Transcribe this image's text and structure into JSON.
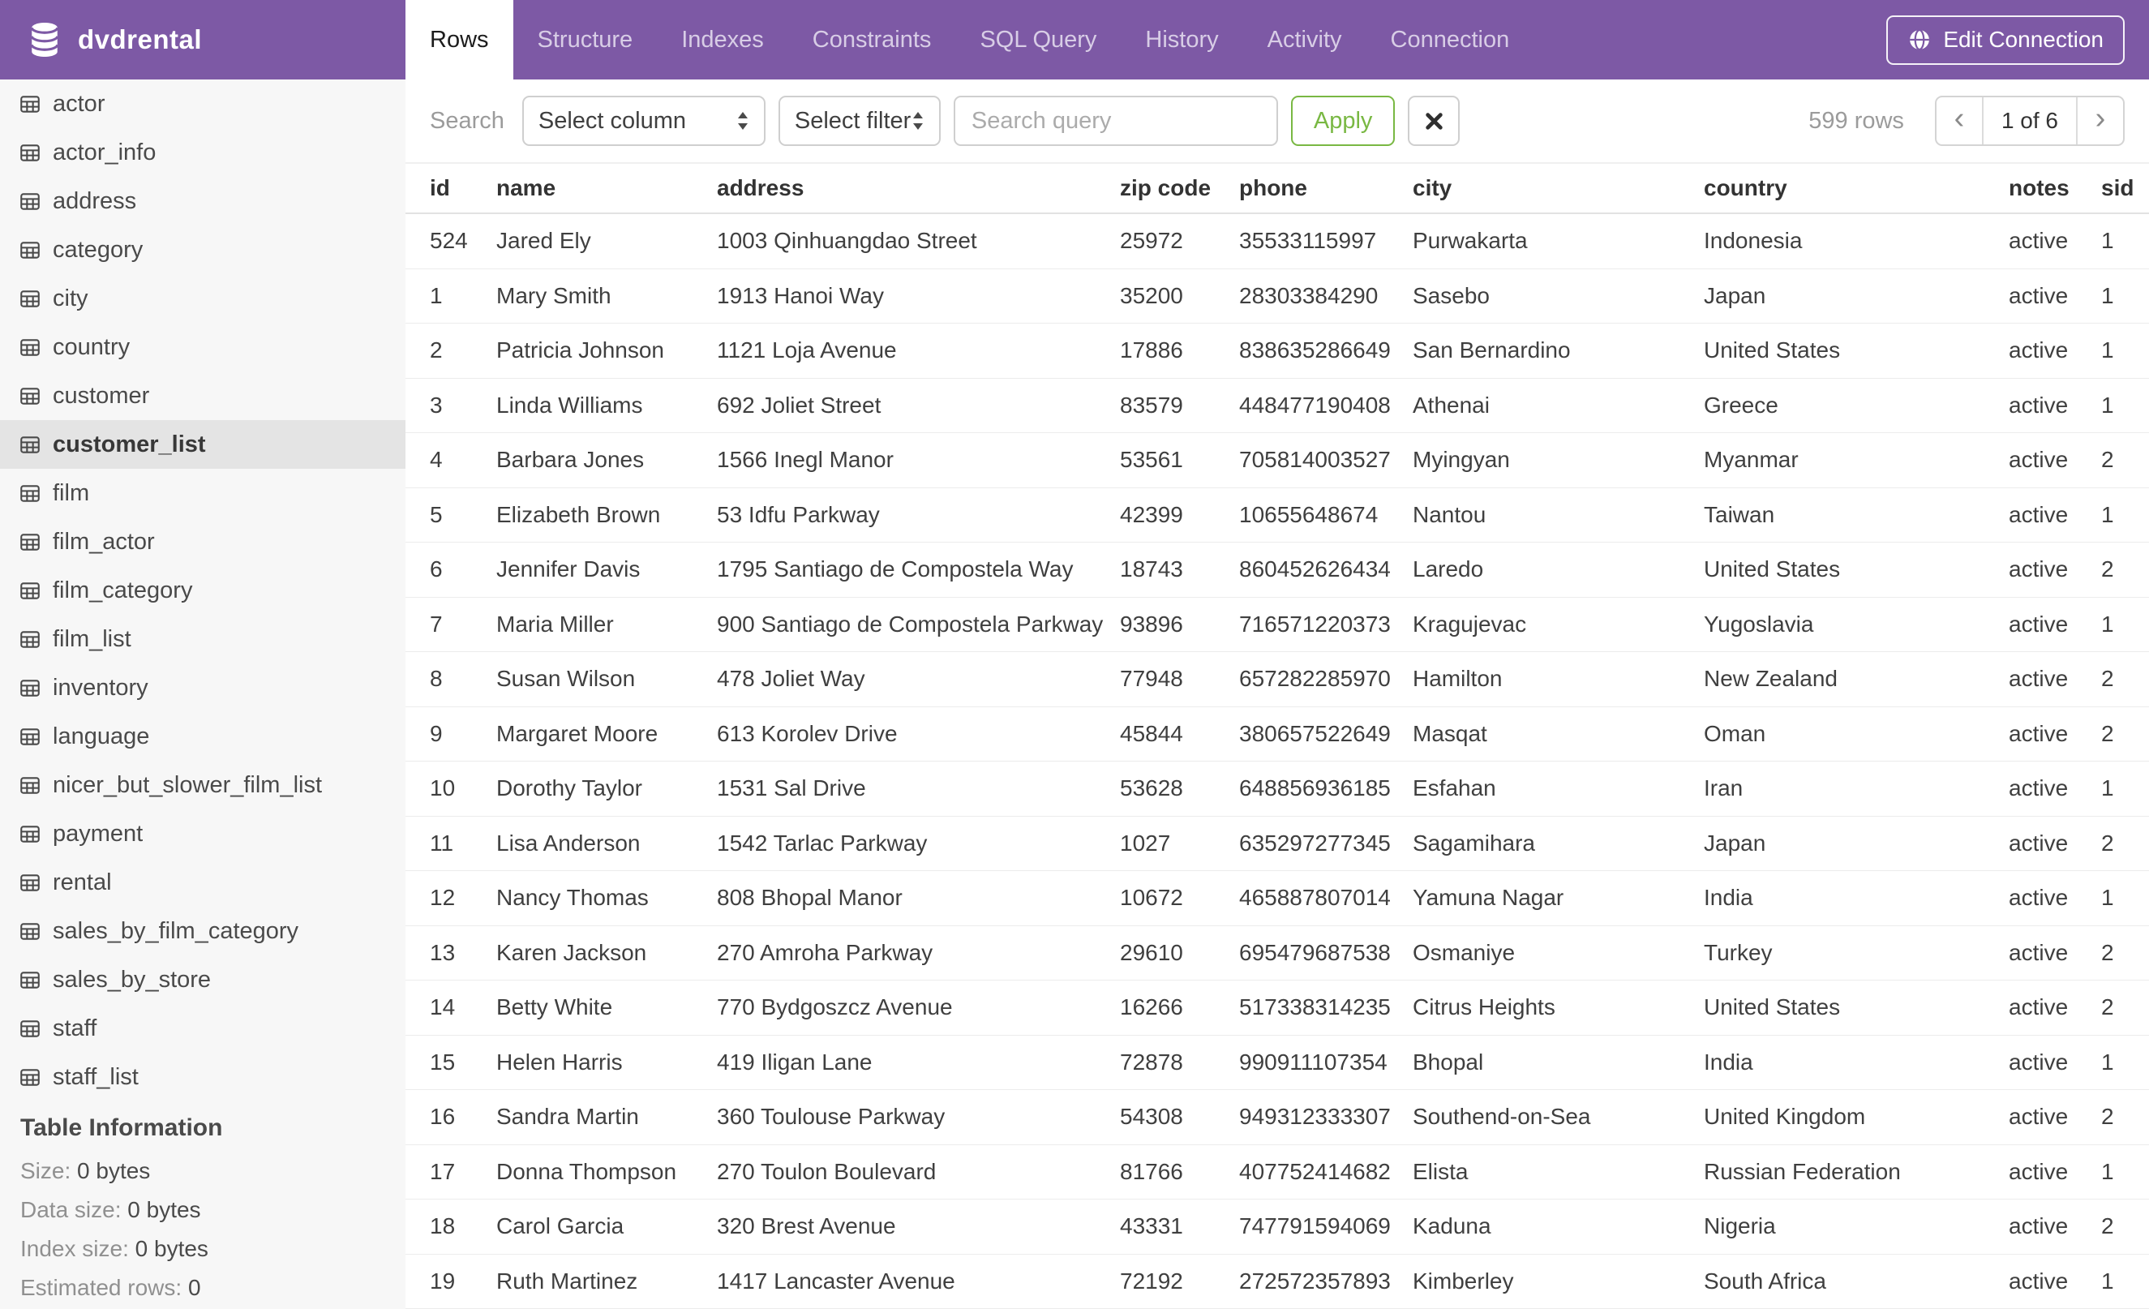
{
  "header": {
    "brand": "dvdrental",
    "tabs": [
      {
        "label": "Rows",
        "active": true
      },
      {
        "label": "Structure",
        "active": false
      },
      {
        "label": "Indexes",
        "active": false
      },
      {
        "label": "Constraints",
        "active": false
      },
      {
        "label": "SQL Query",
        "active": false
      },
      {
        "label": "History",
        "active": false
      },
      {
        "label": "Activity",
        "active": false
      },
      {
        "label": "Connection",
        "active": false
      }
    ],
    "edit_connection_label": "Edit Connection"
  },
  "sidebar": {
    "tables": [
      "actor",
      "actor_info",
      "address",
      "category",
      "city",
      "country",
      "customer",
      "customer_list",
      "film",
      "film_actor",
      "film_category",
      "film_list",
      "inventory",
      "language",
      "nicer_but_slower_film_list",
      "payment",
      "rental",
      "sales_by_film_category",
      "sales_by_store",
      "staff",
      "staff_list"
    ],
    "selected_table": "customer_list",
    "info": {
      "heading": "Table Information",
      "items": [
        {
          "label": "Size:",
          "value": "0 bytes"
        },
        {
          "label": "Data size:",
          "value": "0 bytes"
        },
        {
          "label": "Index size:",
          "value": "0 bytes"
        },
        {
          "label": "Estimated rows:",
          "value": "0"
        }
      ]
    }
  },
  "toolbar": {
    "search_label": "Search",
    "column_select_value": "Select column",
    "filter_select_value": "Select filter",
    "query_value": "",
    "query_placeholder": "Search query",
    "apply_label": "Apply",
    "row_count": "599 rows",
    "pagination": {
      "prev": "‹",
      "page": "1 of 6",
      "next": "›"
    }
  },
  "table": {
    "columns": [
      "id",
      "name",
      "address",
      "zip code",
      "phone",
      "city",
      "country",
      "notes",
      "sid"
    ],
    "rows": [
      [
        "524",
        "Jared Ely",
        "1003 Qinhuangdao Street",
        "25972",
        "35533115997",
        "Purwakarta",
        "Indonesia",
        "active",
        "1"
      ],
      [
        "1",
        "Mary Smith",
        "1913 Hanoi Way",
        "35200",
        "28303384290",
        "Sasebo",
        "Japan",
        "active",
        "1"
      ],
      [
        "2",
        "Patricia Johnson",
        "1121 Loja Avenue",
        "17886",
        "838635286649",
        "San Bernardino",
        "United States",
        "active",
        "1"
      ],
      [
        "3",
        "Linda Williams",
        "692 Joliet Street",
        "83579",
        "448477190408",
        "Athenai",
        "Greece",
        "active",
        "1"
      ],
      [
        "4",
        "Barbara Jones",
        "1566 Inegl Manor",
        "53561",
        "705814003527",
        "Myingyan",
        "Myanmar",
        "active",
        "2"
      ],
      [
        "5",
        "Elizabeth Brown",
        "53 Idfu Parkway",
        "42399",
        "10655648674",
        "Nantou",
        "Taiwan",
        "active",
        "1"
      ],
      [
        "6",
        "Jennifer Davis",
        "1795 Santiago de Compostela Way",
        "18743",
        "860452626434",
        "Laredo",
        "United States",
        "active",
        "2"
      ],
      [
        "7",
        "Maria Miller",
        "900 Santiago de Compostela Parkway",
        "93896",
        "716571220373",
        "Kragujevac",
        "Yugoslavia",
        "active",
        "1"
      ],
      [
        "8",
        "Susan Wilson",
        "478 Joliet Way",
        "77948",
        "657282285970",
        "Hamilton",
        "New Zealand",
        "active",
        "2"
      ],
      [
        "9",
        "Margaret Moore",
        "613 Korolev Drive",
        "45844",
        "380657522649",
        "Masqat",
        "Oman",
        "active",
        "2"
      ],
      [
        "10",
        "Dorothy Taylor",
        "1531 Sal Drive",
        "53628",
        "648856936185",
        "Esfahan",
        "Iran",
        "active",
        "1"
      ],
      [
        "11",
        "Lisa Anderson",
        "1542 Tarlac Parkway",
        "1027",
        "635297277345",
        "Sagamihara",
        "Japan",
        "active",
        "2"
      ],
      [
        "12",
        "Nancy Thomas",
        "808 Bhopal Manor",
        "10672",
        "465887807014",
        "Yamuna Nagar",
        "India",
        "active",
        "1"
      ],
      [
        "13",
        "Karen Jackson",
        "270 Amroha Parkway",
        "29610",
        "695479687538",
        "Osmaniye",
        "Turkey",
        "active",
        "2"
      ],
      [
        "14",
        "Betty White",
        "770 Bydgoszcz Avenue",
        "16266",
        "517338314235",
        "Citrus Heights",
        "United States",
        "active",
        "2"
      ],
      [
        "15",
        "Helen Harris",
        "419 Iligan Lane",
        "72878",
        "990911107354",
        "Bhopal",
        "India",
        "active",
        "1"
      ],
      [
        "16",
        "Sandra Martin",
        "360 Toulouse Parkway",
        "54308",
        "949312333307",
        "Southend-on-Sea",
        "United Kingdom",
        "active",
        "2"
      ],
      [
        "17",
        "Donna Thompson",
        "270 Toulon Boulevard",
        "81766",
        "407752414682",
        "Elista",
        "Russian Federation",
        "active",
        "1"
      ],
      [
        "18",
        "Carol Garcia",
        "320 Brest Avenue",
        "43331",
        "747791594069",
        "Kaduna",
        "Nigeria",
        "active",
        "2"
      ],
      [
        "19",
        "Ruth Martinez",
        "1417 Lancaster Avenue",
        "72192",
        "272572357893",
        "Kimberley",
        "South Africa",
        "active",
        "1"
      ]
    ]
  },
  "icons": {
    "brand": "database-icon",
    "sidebar_item": "table-grid-icon",
    "edit_connection": "globe-icon",
    "clear": "x-icon",
    "selects": "up-down-arrows-icon"
  },
  "colors": {
    "header_purple": "#7D59A5",
    "active_tab_bg": "#FFFFFF",
    "inactive_tab_text": "#D8CDE6",
    "sidebar_bg": "#F7F7F7",
    "selected_item_bg": "#E4E4E4",
    "apply_green": "#79B843",
    "muted_text": "#9B9B9B",
    "cell_text": "#3F3F3F",
    "row_separator": "#ECECEC"
  }
}
